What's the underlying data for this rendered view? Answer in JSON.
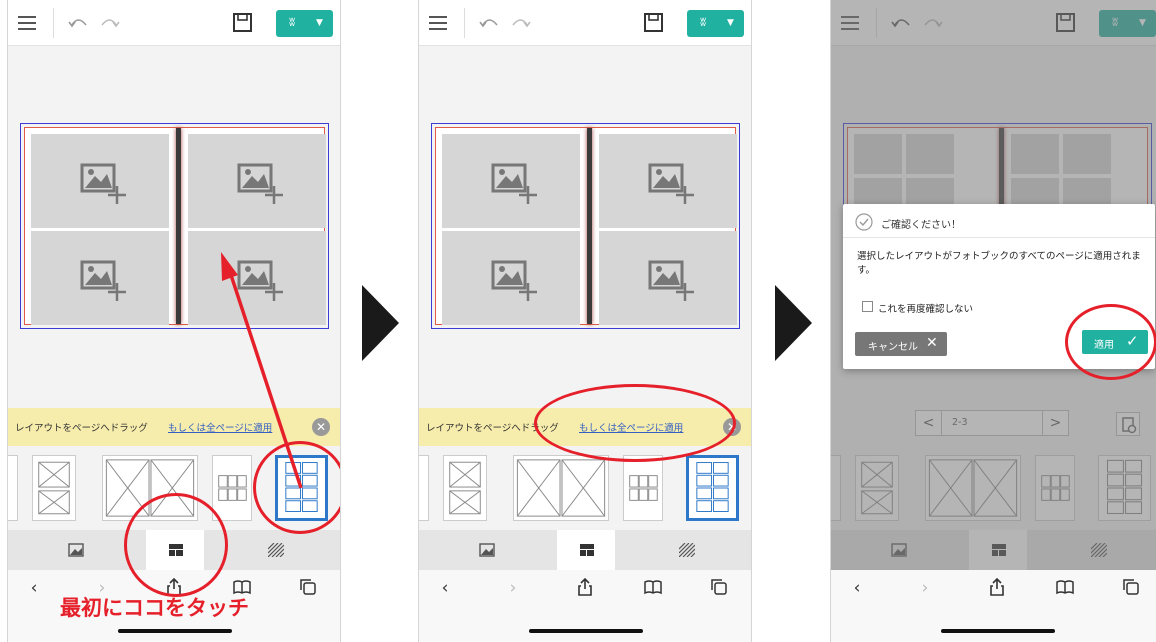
{
  "panels": [
    {
      "banner": {
        "text": "レイアウトをページへドラッグ",
        "link": "もしくは全ページに適用"
      }
    },
    {
      "banner": {
        "text": "レイアウトをページへドラッグ",
        "link": "もしくは全ページに適用"
      }
    }
  ],
  "annotation": {
    "instruction": "最初にココをタッチ"
  },
  "dialog": {
    "title": "ご確認ください！",
    "message": "選択したレイアウトがフォトブックのすべてのページに適用されます。",
    "checkbox_label": "これを再度確認しない",
    "cancel_label": "キャンセル",
    "apply_label": "適用"
  },
  "pager": {
    "value": "2-3",
    "prev": "<",
    "next": ">"
  },
  "icons": {
    "menu": "menu-icon",
    "undo": "undo-icon",
    "redo": "redo-icon",
    "save": "save-icon",
    "cart": "cart-icon",
    "photo_add": "photo-add-icon",
    "close": "close-icon",
    "back": "back-icon",
    "forward": "forward-icon",
    "share": "share-icon",
    "bookmarks": "bookmarks-icon",
    "tabs": "tabs-icon",
    "check": "check-icon"
  },
  "colors": {
    "accent": "#20b1a0",
    "annotation": "#e5202a",
    "banner": "#f6ecac",
    "selected": "#2d78c8"
  }
}
